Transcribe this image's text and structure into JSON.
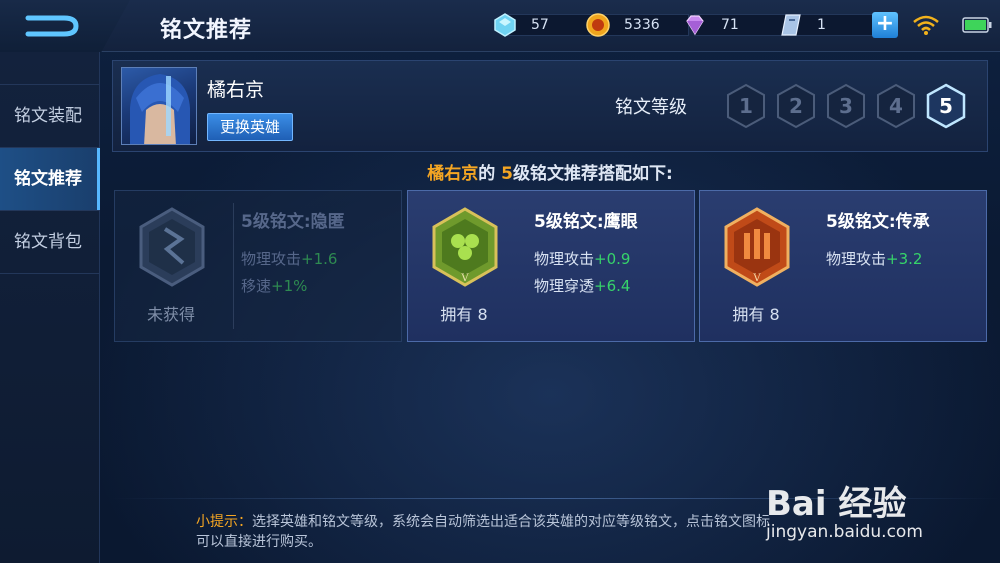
{
  "header": {
    "page_title": "铭文推荐",
    "resources": [
      {
        "name": "crystal",
        "icon": "crystal-icon",
        "value": "57"
      },
      {
        "name": "gold",
        "icon": "gold-coin-icon",
        "value": "5336"
      },
      {
        "name": "diamond",
        "icon": "diamond-icon",
        "value": "71"
      },
      {
        "name": "ticket",
        "icon": "ticket-icon",
        "value": "1"
      }
    ]
  },
  "sidebar": {
    "items": [
      {
        "label": "铭文装配",
        "active": false
      },
      {
        "label": "铭文推荐",
        "active": true
      },
      {
        "label": "铭文背包",
        "active": false
      }
    ]
  },
  "hero": {
    "name": "橘右京",
    "change_label": "更换英雄"
  },
  "level_selector": {
    "label": "铭文等级",
    "levels": [
      "1",
      "2",
      "3",
      "4",
      "5"
    ],
    "selected": "5"
  },
  "recommendation": {
    "hero": "橘右京",
    "mid": "的",
    "level": "5",
    "suffix": "级铭文推荐搭配如下:"
  },
  "cards": [
    {
      "name": "5级铭文:隐匿",
      "status": "未获得",
      "owned": false,
      "stats": [
        {
          "label": "物理攻击",
          "value": "+1.6"
        },
        {
          "label": "移速",
          "value": "+1%"
        }
      ]
    },
    {
      "name": "5级铭文:鹰眼",
      "status": "拥有 8",
      "owned": true,
      "stats": [
        {
          "label": "物理攻击",
          "value": "+0.9"
        },
        {
          "label": "物理穿透",
          "value": "+6.4"
        }
      ]
    },
    {
      "name": "5级铭文:传承",
      "status": "拥有 8",
      "owned": true,
      "stats": [
        {
          "label": "物理攻击",
          "value": "+3.2"
        }
      ]
    }
  ],
  "tip": {
    "label": "小提示：",
    "line1": "选择英雄和铭文等级，系统会自动筛选出适合该英雄的对应等级铭文，点击铭文图标",
    "line2": "可以直接进行购买。"
  },
  "watermark": {
    "logo": "Bai 经验",
    "url": "jingyan.baidu.com"
  },
  "colors": {
    "accent_orange": "#f5a623",
    "stat_green": "#36d36a",
    "active_blue": "#1e4f86"
  }
}
